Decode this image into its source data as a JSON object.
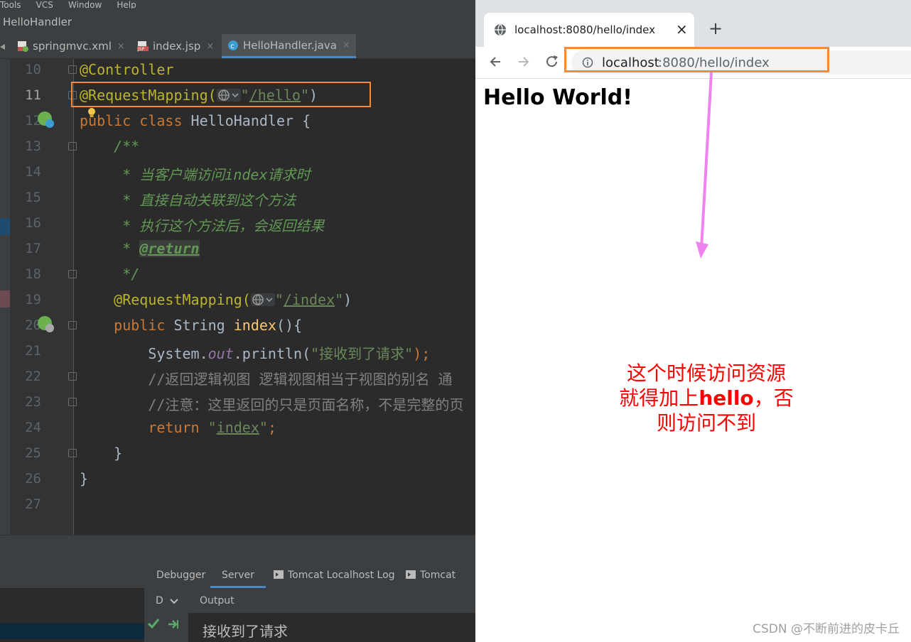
{
  "ide": {
    "menu": [
      "Tools",
      "VCS",
      "Window",
      "Help"
    ],
    "title": "HelloHandler",
    "tabs": [
      {
        "label": "springmvc.xml",
        "close": "×"
      },
      {
        "label": "index.jsp",
        "close": "×"
      },
      {
        "label": "HelloHandler.java",
        "close": "×"
      }
    ],
    "line_numbers": [
      "10",
      "11",
      "12",
      "13",
      "14",
      "15",
      "16",
      "17",
      "18",
      "19",
      "20",
      "21",
      "22",
      "23",
      "24",
      "25",
      "26",
      "27"
    ],
    "code": {
      "l10": "@Controller",
      "l11_ann": "@RequestMapping(",
      "l11_q1": "\"",
      "l11_path": "/hello",
      "l11_q2": "\"",
      "l11_end": ")",
      "l12_kw": "public class ",
      "l12_name": "HelloHandler {",
      "l13": "    /**",
      "l14": "     * 当客户端访问index请求时",
      "l15": "     * 直接自动关联到这个方法",
      "l16": "     * 执行这个方法后，会返回结果",
      "l17_pre": "     * ",
      "l17_tag": "@return",
      "l18": "     */",
      "l19_ann": "    @RequestMapping(",
      "l19_q1": "\"",
      "l19_path": "/index",
      "l19_q2": "\"",
      "l19_end": ")",
      "l20_kw": "    public ",
      "l20_type": "String ",
      "l20_name": "index",
      "l20_end": "(){",
      "l21_a": "        System.",
      "l21_out": "out",
      "l21_b": ".println(",
      "l21_str": "\"接收到了请求\"",
      "l21_end": ");",
      "l22": "        //返回逻辑视图 逻辑视图相当于视图的别名 通",
      "l23": "        //注意：这里返回的只是页面名称，不是完整的页",
      "l24_kw": "        return ",
      "l24_q1": "\"",
      "l24_str": "index",
      "l24_q2": "\"",
      "l24_end": ";",
      "l25": "    }",
      "l26": "}"
    },
    "bottom_tabs": [
      "Debugger",
      "Server",
      "Tomcat Localhost Log",
      "Tomcat Cata"
    ],
    "output_header": "Output",
    "output_selector": "D",
    "output_text": "接收到了请求"
  },
  "browser": {
    "tab_title": "localhost:8080/hello/index",
    "tab_close": "×",
    "new_tab": "+",
    "url_host": "localhost",
    "url_rest": ":8080/hello/index",
    "page_heading": "Hello World!"
  },
  "annotation": {
    "line1": "这个时候访问资源",
    "line2_pre": "就得加上",
    "line2_bold": "hello",
    "line2_post": "，否",
    "line3": "则访问不到"
  },
  "watermark": "CSDN @不断前进的皮卡丘",
  "colors": {
    "highlight_box": "#f08a3c",
    "arrow": "#ee82ee",
    "note": "#ff0000"
  }
}
